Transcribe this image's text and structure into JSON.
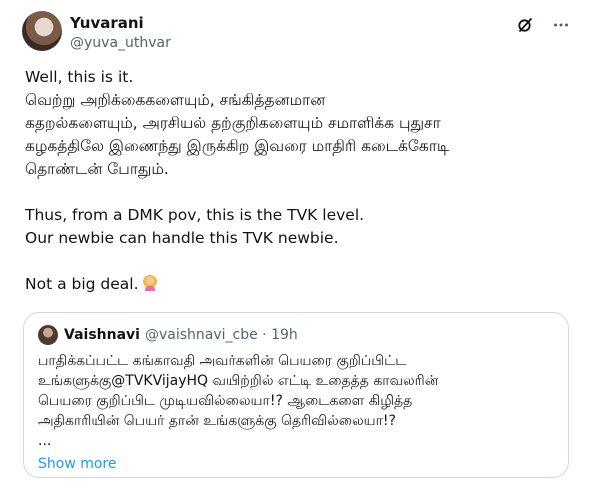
{
  "author": {
    "name": "Yuvarani",
    "handle": "@yuva_uthvar"
  },
  "post": {
    "lines": [
      "Well, this is it.",
      "வெற்று அறிக்கைகளையும், சங்கித்தனமான",
      "கதறல்களையும், அரசியல் தற்குறிகளையும் சமாளிக்க புதுசா",
      "கழகத்திலே இணைந்து இருக்கிற இவரை மாதிரி கடைக்கோடி",
      "தொண்டன் போதும்.",
      "",
      "Thus, from a DMK pov, this is the TVK level.",
      "Our newbie can handle this TVK newbie.",
      "",
      "Not a big deal."
    ],
    "emoji": "woman-shrugging-emoji"
  },
  "quote": {
    "name": "Vaishnavi",
    "handle_time": "@vaishnavi_cbe · 19h",
    "lines": [
      "பாதிக்கப்பட்ட கங்காவதி அவர்களின் பெயரை குறிப்பிட்ட",
      "உங்களுக்கு@TVKVijayHQ வயிற்றில் எட்டி உதைத்த காவலரின்",
      "பெயரை குறிப்பிட முடியவில்லையா!? ஆடைகளை கிழித்த",
      "அதிகாரியின் பெயர் தான் உங்களுக்கு தெரிவில்லையா!?",
      "..."
    ],
    "show_more": "Show more"
  },
  "icons": {
    "grok": "grok-icon",
    "more": "more-icon"
  },
  "colors": {
    "text": "#0f1419",
    "muted": "#536471",
    "link": "#1d9bf0",
    "border": "#cfd9de"
  }
}
